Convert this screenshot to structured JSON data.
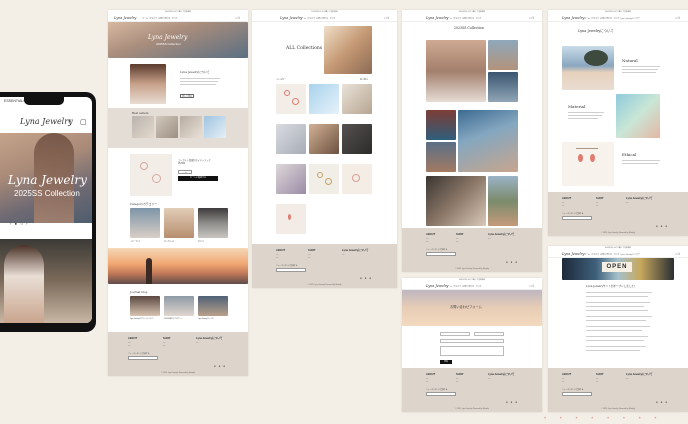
{
  "mockup_header": {
    "logo": "Lyna Jewelry",
    "announcement": "10000円以上のご購入で送料無料",
    "nav": [
      "ホーム",
      "カタログ",
      "お問い合わせ",
      "ブログ",
      "Lyna Jewelryについて"
    ]
  },
  "tablet": {
    "logo": "Lyna Jewelry",
    "cut_top": "ESSENTIALS",
    "cut_top2": "カタログ",
    "hero_title": "Lyna Jewelry",
    "hero_subtitle": "2025SS Collection"
  },
  "home_page": {
    "hero_title": "Lyna Jewelry",
    "hero_subtitle": "2025SS Collection",
    "about_title": "Lyna Jewelryについて",
    "about_button": "詳しく見る",
    "bestseller_title": "Best sellers",
    "featured_title": "エレガント真珠付きイヤーフック",
    "featured_price": "¥5,500",
    "add_button": "カートに追加する",
    "category_title": "Categoryカテゴリー",
    "category_items": [
      "イヤーカフ",
      "ネックレス",
      "ピアス"
    ],
    "journal_title": "Journal blog",
    "journal_items": [
      "Lyna Jewelryのブランドについて",
      "2025SS新作アクセサリー",
      "Lyna Jewelryサイトが"
    ]
  },
  "collections_page": {
    "title": "ALL Collections",
    "filter": "フィルター",
    "sort": "並べ替え"
  },
  "collection2025_page": {
    "title": "2025SS Collection"
  },
  "contact_page": {
    "title": "お問い合わせフォーム",
    "submit": "送信"
  },
  "about_page": {
    "title": "Lyna Jewelryについて",
    "section_natural": "Natural",
    "section_material": "Material",
    "section_ethical": "Ethical"
  },
  "blog_page": {
    "title": "Lyna Jewelryサイトがオープンしました！"
  },
  "footer": {
    "col1_title": "ABOUT",
    "col2_title": "SHOP",
    "col3_title": "Lyna Jewelryについて",
    "newsletter": "ニュースレターに登録する",
    "copyright": "© 2025, Lyna Jewelry Powered by Shopify"
  },
  "colors": {
    "background": "#f4efe6",
    "footer": "#ddd4cb",
    "band": "#e4ddd5",
    "accent_pink": "#d8a7a0",
    "text": "#333333"
  }
}
